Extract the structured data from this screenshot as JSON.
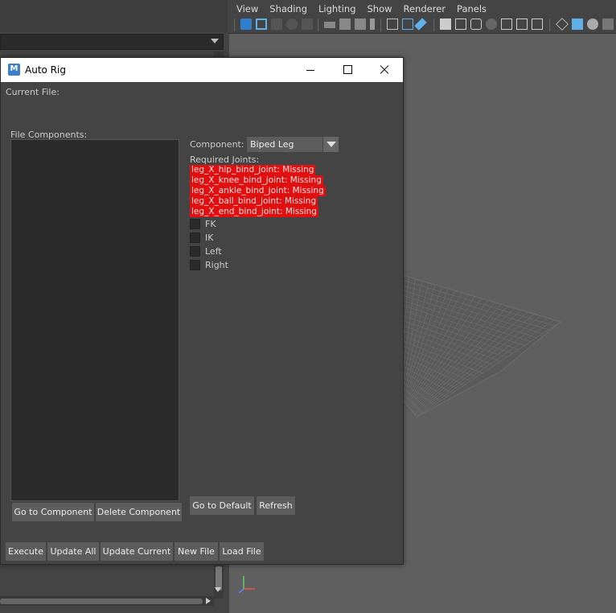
{
  "viewport": {
    "menu": [
      "View",
      "Shading",
      "Lighting",
      "Show",
      "Renderer",
      "Panels"
    ]
  },
  "dialog": {
    "title": "Auto Rig",
    "current_file_label": "Current File:",
    "file_components_label": "File Components:",
    "component_label": "Component:",
    "component_value": "Biped Leg",
    "required_joints_label": "Required Joints:",
    "joints": [
      "leg_X_hip_bind_joint: Missing",
      "leg_X_knee_bind_joint: Missing",
      "leg_X_ankle_bind_joint: Missing",
      "leg_X_ball_bind_joint: Missing",
      "leg_X_end_bind_joint: Missing"
    ],
    "options": [
      "FK",
      "IK",
      "Left",
      "Right"
    ],
    "buttons": {
      "go_to_component": "Go to Component",
      "delete_component": "Delete Component",
      "go_to_default": "Go to Default",
      "refresh": "Refresh",
      "execute": "Execute",
      "update_all": "Update All",
      "update_current": "Update Current",
      "new_file": "New File",
      "load_file": "Load File"
    }
  },
  "colors": {
    "missing_joint": "#e01010",
    "dialog_bg": "#444444",
    "viewport_bg": "#5f5f5f"
  },
  "icons": [
    "maya-app-icon",
    "minimize-icon",
    "maximize-icon",
    "close-icon",
    "dropdown-arrow-icon",
    "axis-gizmo-icon"
  ]
}
